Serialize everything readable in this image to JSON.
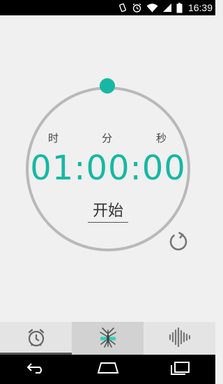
{
  "status_bar": {
    "time": "16:39",
    "icons": [
      "rotate-icon",
      "alarm-icon",
      "wifi-icon",
      "signal-icon",
      "battery-icon"
    ]
  },
  "timer": {
    "labels": {
      "hours": "时",
      "minutes": "分",
      "seconds": "秒"
    },
    "display": "01:00:00",
    "start_label": "开始",
    "accent_color": "#17b8a3",
    "ring_color": "#b8b9b8"
  },
  "tabs": [
    {
      "icon": "alarm-clock-icon"
    },
    {
      "icon": "mosquito-icon",
      "active": true
    },
    {
      "icon": "sound-wave-icon"
    }
  ],
  "nav": {
    "icons": [
      "back-icon",
      "home-icon",
      "recents-icon"
    ]
  }
}
